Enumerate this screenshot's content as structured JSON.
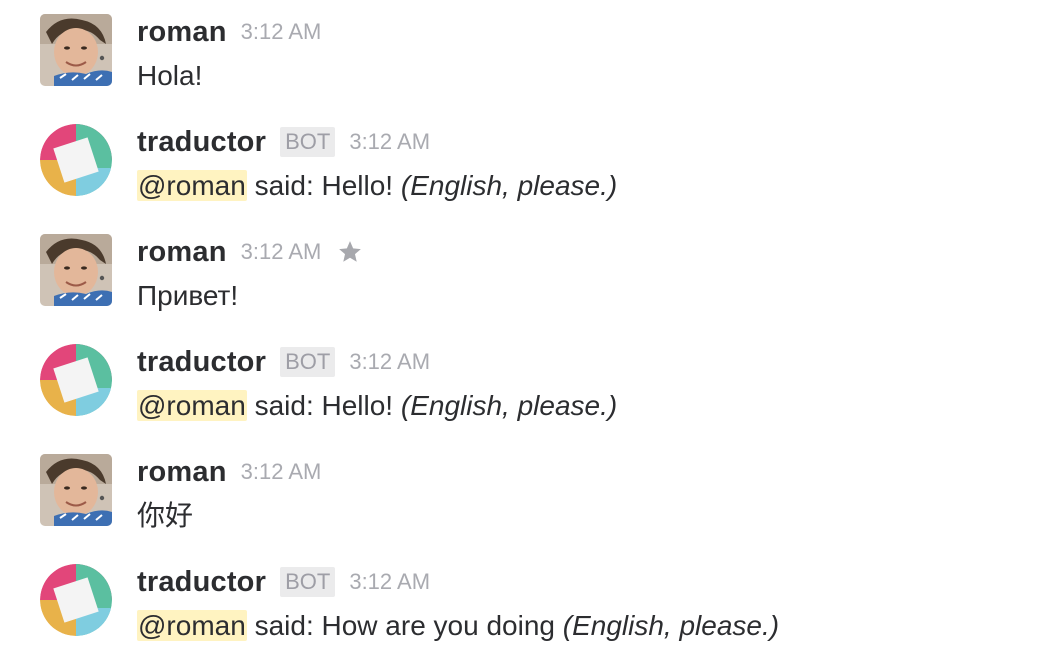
{
  "messages": [
    {
      "author": "roman",
      "time": "3:12 AM",
      "text": "Hola!"
    },
    {
      "author": "traductor",
      "badge": "BOT",
      "time": "3:12 AM",
      "mention": "@roman",
      "text": " said: Hello! ",
      "note": "(English, please.)"
    },
    {
      "author": "roman",
      "time": "3:12 AM",
      "text": "Привет!",
      "icon": "star-icon"
    },
    {
      "author": "traductor",
      "badge": "BOT",
      "time": "3:12 AM",
      "mention": "@roman",
      "text": " said: Hello! ",
      "note": "(English, please.)"
    },
    {
      "author": "roman",
      "time": "3:12 AM",
      "text": "你好"
    },
    {
      "author": "traductor",
      "badge": "BOT",
      "time": "3:12 AM",
      "mention": "@roman",
      "text": " said: How are you doing ",
      "note": "(English, please.)"
    }
  ],
  "colors": {
    "mention_highlight": "#fff3c1",
    "timestamp": "#a9aab0",
    "author": "#2c2d30",
    "bot_badge_bg": "#ebebec"
  }
}
